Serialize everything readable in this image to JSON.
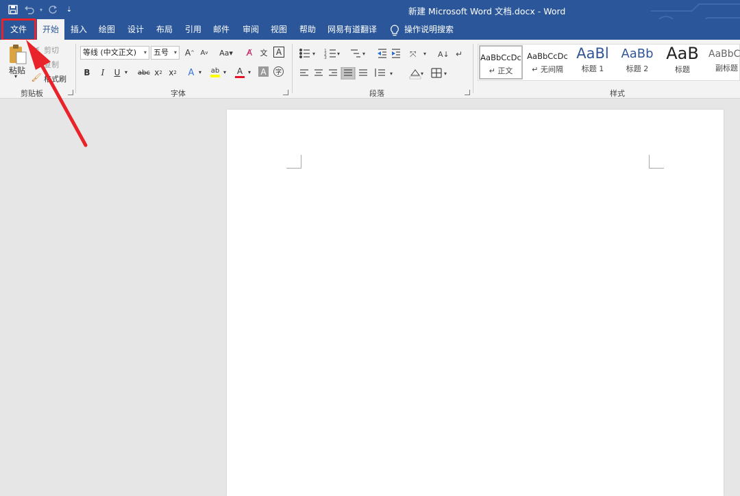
{
  "titlebar": {
    "title": "新建 Microsoft Word 文档.docx  -  Word",
    "bg_color": "#2b579a"
  },
  "quick_access": {
    "save_icon": "save-icon",
    "undo_icon": "undo-icon",
    "redo_icon": "redo-icon",
    "customize_glyph": "⇣"
  },
  "tabs": [
    {
      "label": "文件"
    },
    {
      "label": "开始"
    },
    {
      "label": "插入"
    },
    {
      "label": "绘图"
    },
    {
      "label": "设计"
    },
    {
      "label": "布局"
    },
    {
      "label": "引用"
    },
    {
      "label": "邮件"
    },
    {
      "label": "审阅"
    },
    {
      "label": "视图"
    },
    {
      "label": "帮助"
    },
    {
      "label": "网易有道翻译"
    }
  ],
  "tell_me": "操作说明搜索",
  "clipboard": {
    "paste": "粘贴",
    "cut": "剪切",
    "copy": "复制",
    "format_painter": "格式刷",
    "group": "剪贴板"
  },
  "font": {
    "name": "等线 (中文正文)",
    "size": "五号",
    "grow": "A",
    "shrink": "A",
    "case": "Aa",
    "bold": "B",
    "italic": "I",
    "underline": "U",
    "strike": "abc",
    "sub": "x",
    "sup": "x",
    "font_color_letter": "A",
    "shading_letter": "A",
    "group": "字体",
    "font_color": "#e81123",
    "highlight_color": "#ffff00"
  },
  "paragraph": {
    "group": "段落"
  },
  "styles": {
    "group": "样式",
    "items": [
      {
        "sample": "AaBbCcDc",
        "name": "↵ 正文"
      },
      {
        "sample": "AaBbCcDc",
        "name": "↵ 无间隔"
      },
      {
        "sample": "AaBl",
        "name": "标题 1"
      },
      {
        "sample": "AaBb",
        "name": "标题 2"
      },
      {
        "sample": "AaB",
        "name": "标题"
      },
      {
        "sample": "AaBbC",
        "name": "副标题"
      }
    ]
  },
  "annotation": {
    "highlight_color": "#e8232a"
  }
}
